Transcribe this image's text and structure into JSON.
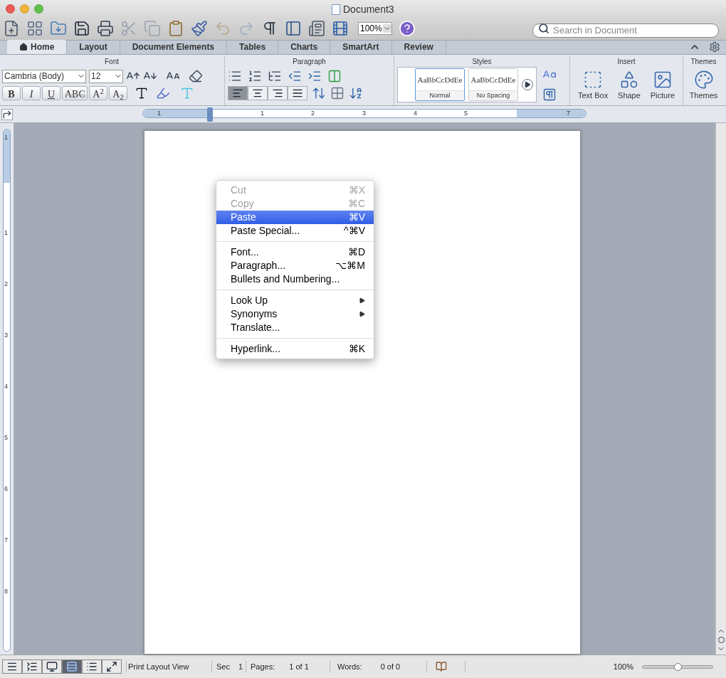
{
  "window": {
    "title": "Document3"
  },
  "toolbar": {
    "zoom": "100%",
    "search": {
      "placeholder": "Search in Document"
    }
  },
  "tabs": [
    {
      "label": "Home",
      "selected": true
    },
    {
      "label": "Layout",
      "selected": false
    },
    {
      "label": "Document Elements",
      "selected": false
    },
    {
      "label": "Tables",
      "selected": false
    },
    {
      "label": "Charts",
      "selected": false
    },
    {
      "label": "SmartArt",
      "selected": false
    },
    {
      "label": "Review",
      "selected": false
    }
  ],
  "ribbon": {
    "font": {
      "title": "Font",
      "family": "Cambria (Body)",
      "size": "12",
      "styles": [
        "B",
        "I",
        "U",
        "ABC",
        "A$^{2}$",
        "A$_{2}$"
      ]
    },
    "paragraph": {
      "title": "Paragraph",
      "alignments": [
        {
          "selected": true
        },
        {
          "selected": false
        },
        {
          "selected": false
        },
        {
          "selected": false
        }
      ]
    },
    "styles": {
      "title": "Styles",
      "items": [
        {
          "sample": "AaBbCcDdEe",
          "name": "Normal",
          "selected": true
        },
        {
          "sample": "AaBbCcDdEe",
          "name": "No Spacing",
          "selected": false
        }
      ]
    },
    "insert": {
      "title": "Insert",
      "items": [
        "Text Box",
        "Shape",
        "Picture"
      ]
    },
    "themes": {
      "title": "Themes",
      "label": "Themes"
    }
  },
  "ruler": {
    "marks": [
      "1",
      "1",
      "2",
      "3",
      "4",
      "5",
      "7"
    ]
  },
  "vertical_ruler": {
    "marks": [
      "1",
      "1",
      "2",
      "3",
      "4",
      "5",
      "6",
      "7",
      "8"
    ]
  },
  "context_menu": {
    "groups": [
      [
        {
          "label": "Cut",
          "shortcut": "⌘X",
          "disabled": true,
          "selected": false,
          "submenu": false
        },
        {
          "label": "Copy",
          "shortcut": "⌘C",
          "disabled": true,
          "selected": false,
          "submenu": false
        },
        {
          "label": "Paste",
          "shortcut": "⌘V",
          "disabled": false,
          "selected": true,
          "submenu": false
        },
        {
          "label": "Paste Special...",
          "shortcut": "^⌘V",
          "disabled": false,
          "selected": false,
          "submenu": false
        }
      ],
      [
        {
          "label": "Font...",
          "shortcut": "⌘D",
          "disabled": false,
          "selected": false,
          "submenu": false
        },
        {
          "label": "Paragraph...",
          "shortcut": "⌥⌘M",
          "disabled": false,
          "selected": false,
          "submenu": false
        },
        {
          "label": "Bullets and Numbering...",
          "disabled": false,
          "selected": false,
          "submenu": false
        }
      ],
      [
        {
          "label": "Look Up",
          "disabled": false,
          "selected": false,
          "submenu": true
        },
        {
          "label": "Synonyms",
          "disabled": false,
          "selected": false,
          "submenu": true
        },
        {
          "label": "Translate...",
          "disabled": false,
          "selected": false,
          "submenu": false
        }
      ],
      [
        {
          "label": "Hyperlink...",
          "shortcut": "⌘K",
          "disabled": false,
          "selected": false,
          "submenu": false
        }
      ]
    ]
  },
  "status_bar": {
    "views": [
      {
        "selected": false
      },
      {
        "selected": false
      },
      {
        "selected": false
      },
      {
        "selected": true
      },
      {
        "selected": false
      },
      {
        "selected": false
      }
    ],
    "view_name": "Print Layout View",
    "section_label": "Sec",
    "section": "1",
    "pages_label": "Pages:",
    "pages": "1 of 1",
    "words_label": "Words:",
    "words": "0 of 0",
    "zoom": "100%",
    "zoom_slider": {
      "level": 0.5
    }
  }
}
